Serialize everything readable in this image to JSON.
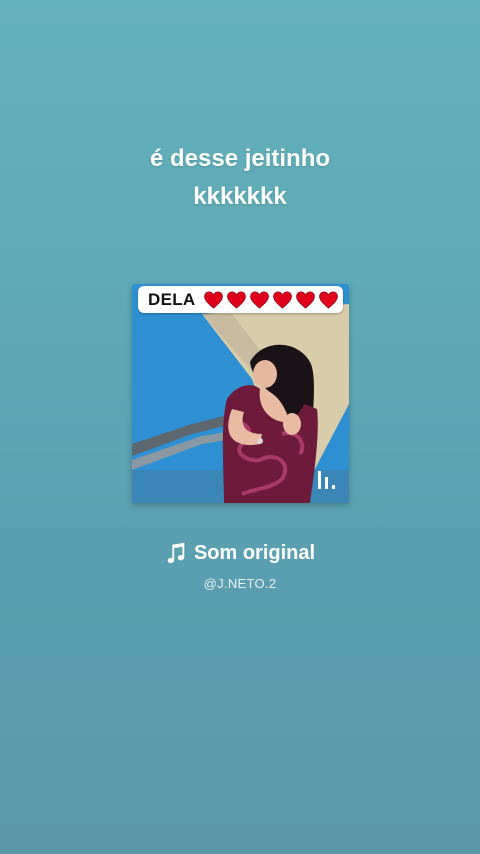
{
  "caption": {
    "line1": "é desse jeitinho",
    "line2": "kkkkkkk"
  },
  "cover": {
    "label_text": "DELA",
    "hearts_count": 6,
    "heart_color": "#e0001b",
    "icon": "audio-bars-icon"
  },
  "sound": {
    "icon": "music-note-icon",
    "title": "Som original",
    "author": "@J.NETO.2"
  },
  "colors": {
    "background_top": "#63b3bd",
    "background_bottom": "#5a98a8",
    "text": "#ffffff"
  }
}
